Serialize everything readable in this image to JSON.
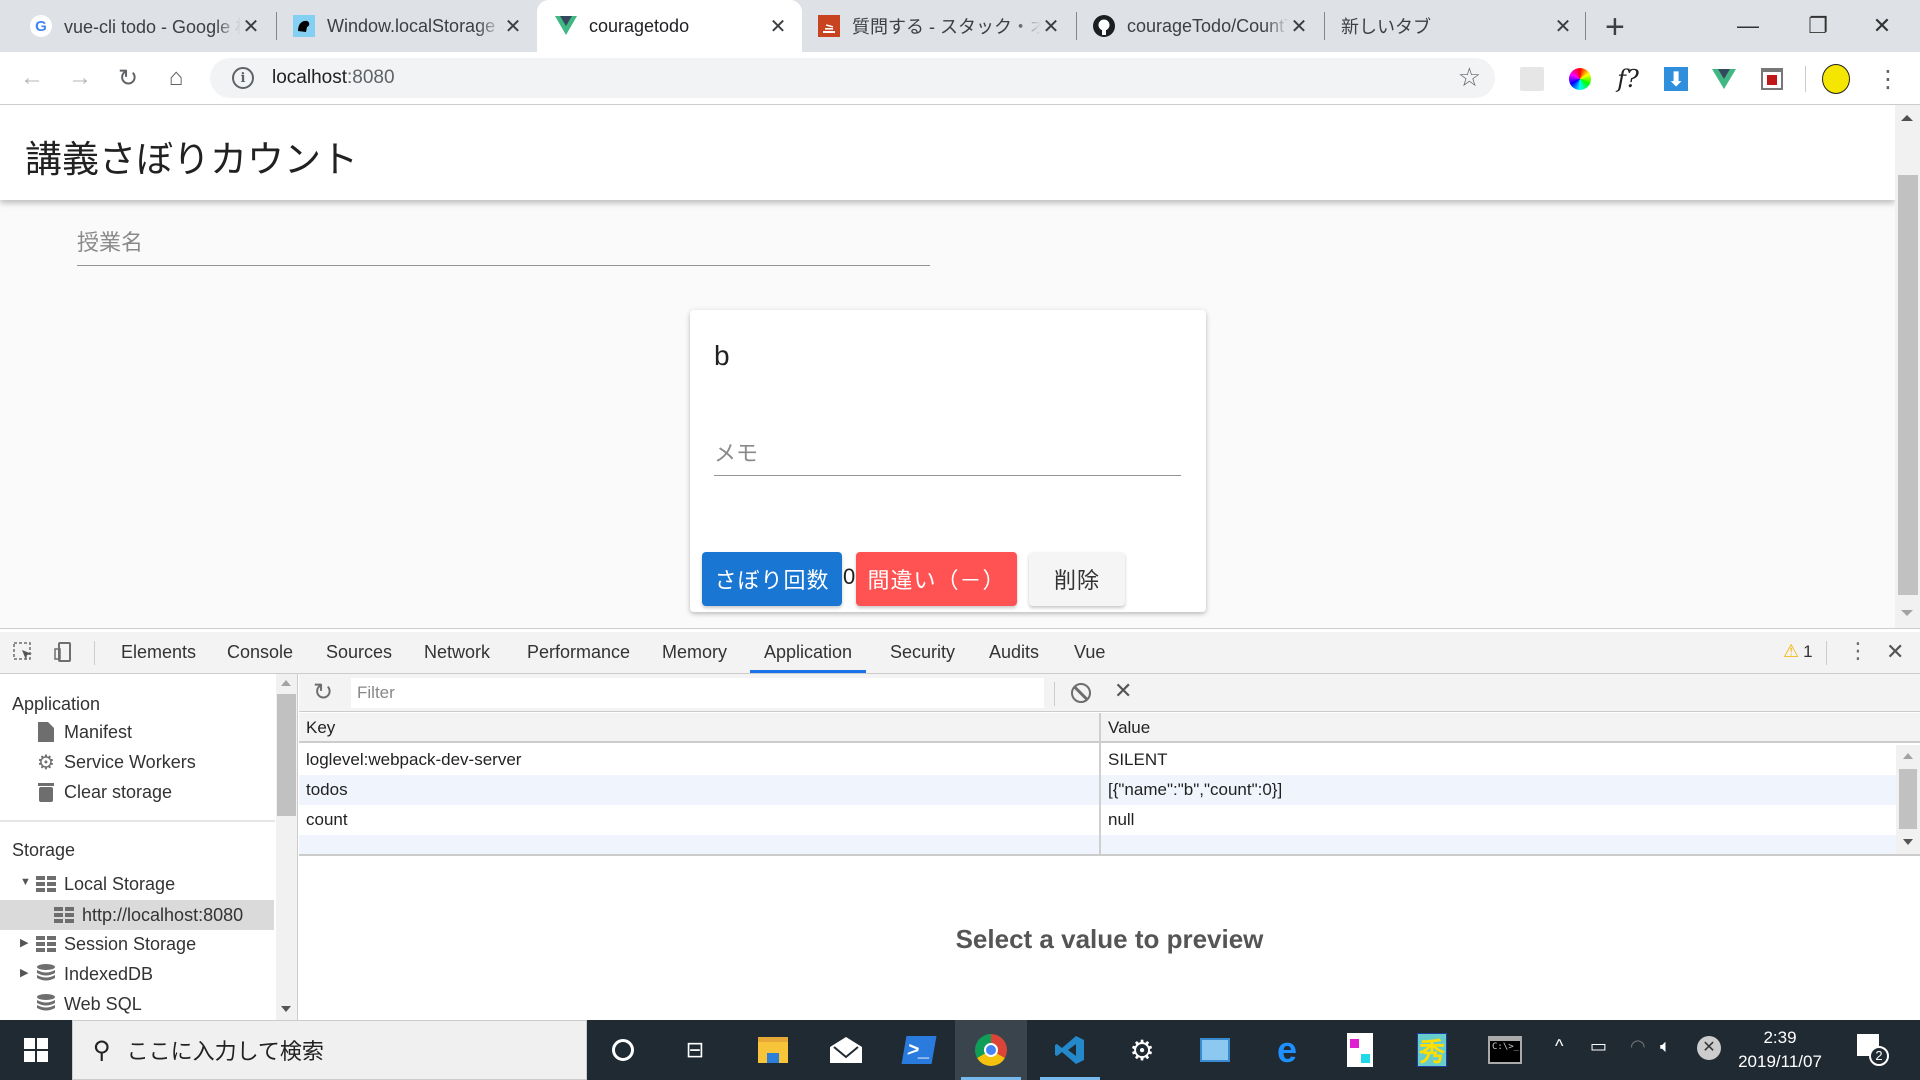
{
  "browser": {
    "tabs": [
      {
        "title": "vue-cli todo - Google 検索",
        "icon": "google-icon",
        "active": false
      },
      {
        "title": "Window.localStorage - Web API",
        "icon": "mdn-icon",
        "active": false
      },
      {
        "title": "couragetodo",
        "icon": "vue-icon",
        "active": true
      },
      {
        "title": "質問する - スタック・オーバーフロー",
        "icon": "stackoverflow-icon",
        "active": false
      },
      {
        "title": "courageTodo/CountTodo",
        "icon": "github-icon",
        "active": false
      },
      {
        "title": "新しいタブ",
        "icon": "",
        "active": false
      }
    ],
    "new_tab_label": "+",
    "url_host": "localhost",
    "url_port": ":8080",
    "extensions": [
      "react-devtools-icon",
      "color-picker-icon",
      "whatfont-icon",
      "download-icon",
      "vue-devtools-icon",
      "mcafee-icon"
    ],
    "window_controls": {
      "minimize": "—",
      "restore": "❐",
      "close": "✕"
    }
  },
  "app": {
    "title": "講義さぼりカウント",
    "lecture_placeholder": "授業名",
    "card": {
      "name": "b",
      "memo_placeholder": "メモ",
      "skip_button": "さぼり回数",
      "count": "0",
      "wrong_button": "間違い（－）",
      "delete_button": "削除"
    },
    "colors": {
      "primary": "#1976d2",
      "error": "#ff5252"
    }
  },
  "devtools": {
    "tabs": [
      "Elements",
      "Console",
      "Sources",
      "Network",
      "Performance",
      "Memory",
      "Application",
      "Security",
      "Audits",
      "Vue"
    ],
    "active_tab": "Application",
    "warning_count": "1",
    "sidebar": {
      "application_heading": "Application",
      "application_items": [
        {
          "label": "Manifest",
          "icon": "file-icon"
        },
        {
          "label": "Service Workers",
          "icon": "gear-icon"
        },
        {
          "label": "Clear storage",
          "icon": "trash-icon"
        }
      ],
      "storage_heading": "Storage",
      "storage_items": [
        {
          "label": "Local Storage",
          "icon": "grid-icon",
          "expanded": true
        },
        {
          "label": "http://localhost:8080",
          "icon": "grid-icon",
          "selected": true
        },
        {
          "label": "Session Storage",
          "icon": "grid-icon",
          "expanded": false
        },
        {
          "label": "IndexedDB",
          "icon": "database-icon",
          "expanded": false
        },
        {
          "label": "Web SQL",
          "icon": "database-icon"
        }
      ]
    },
    "filter_placeholder": "Filter",
    "table": {
      "columns": [
        "Key",
        "Value"
      ],
      "rows": [
        {
          "key": "loglevel:webpack-dev-server",
          "value": "SILENT"
        },
        {
          "key": "todos",
          "value": "[{\"name\":\"b\",\"count\":0}]"
        },
        {
          "key": "count",
          "value": "null"
        }
      ]
    },
    "preview_text": "Select a value to preview"
  },
  "taskbar": {
    "search_placeholder": "ここに入力して検索",
    "time": "2:39",
    "date": "2019/11/07",
    "notification_count": "2"
  }
}
